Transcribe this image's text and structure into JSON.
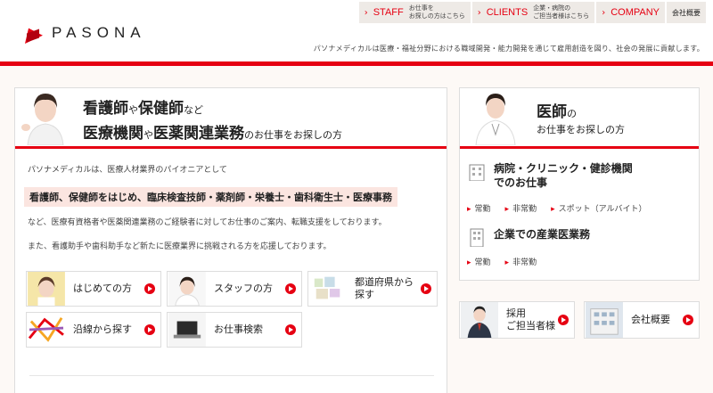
{
  "brand": {
    "name": "PASONA"
  },
  "topnav": [
    {
      "label": "STAFF",
      "sub": "お仕事を\nお探しの方はこちら"
    },
    {
      "label": "CLIENTS",
      "sub": "企業・病院の\nご担当者様はこちら"
    },
    {
      "label": "COMPANY",
      "sub": ""
    },
    {
      "label": "会社概要",
      "sub": ""
    }
  ],
  "tagline": "パソナメディカルは医療・福祉分野における職域開発・能力開発を通じて雇用創造を図り、社会の発展に貢献します。",
  "left": {
    "head1_a": "看護師",
    "head1_b": "や",
    "head1_c": "保健師",
    "head1_d": "など",
    "head2_a": "医療機関",
    "head2_b": "や",
    "head2_c": "医薬関連業務",
    "head2_d": "のお仕事をお探しの方",
    "intro1": "パソナメディカルは、医療人材業界のパイオニアとして",
    "highlight": "看護師、保健師をはじめ、臨床検査技師・薬剤師・栄養士・歯科衛生士・医療事務",
    "intro2": "など、医療有資格者や医薬関連業務のご経験者に対してお仕事のご案内、転職支援をしております。",
    "intro3": "また、看護助手や歯科助手など新たに医療業界に挑戦される方を応援しております。",
    "buttons": {
      "first": "はじめての方",
      "staff": "スタッフの方",
      "prefecture": "都道府県から\n探す",
      "line": "沿線から探す",
      "search": "お仕事検索"
    }
  },
  "right": {
    "head1_a": "医師",
    "head1_b": "の",
    "head2": "お仕事をお探しの方",
    "sec1_title": "病院・クリニック・健診機関\nでのお仕事",
    "sec1_links": [
      "常勤",
      "非常勤",
      "スポット（アルバイト）"
    ],
    "sec2_title": "企業での産業医業務",
    "sec2_links": [
      "常勤",
      "非常勤"
    ]
  },
  "bottom_buttons": {
    "recruit": "採用\nご担当者様",
    "company": "会社概要"
  },
  "colors": {
    "accent": "#e60012",
    "highlight_bg": "#fbe5e0"
  }
}
